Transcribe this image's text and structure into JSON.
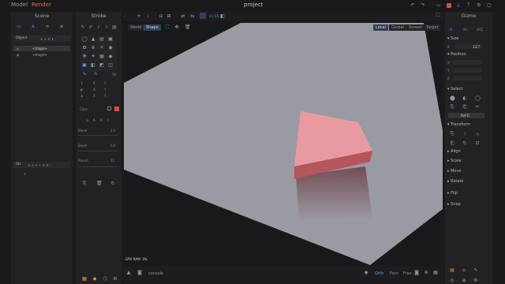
{
  "topbar": {
    "mode_model": "Model",
    "mode_render": "Render",
    "project_title": "project"
  },
  "scene": {
    "title": "Scene",
    "object_header": "Object",
    "items": [
      {
        "label": "<shape>",
        "selected": true
      },
      {
        "label": "<shape>",
        "selected": false
      }
    ],
    "timeline_label": "Str"
  },
  "stroke": {
    "title": "Stroke",
    "xyz": [
      "X",
      "Y",
      "Z"
    ],
    "color_label": "Color",
    "abc": [
      "A",
      "B",
      "C"
    ],
    "blend_label": "Blend",
    "blend_value": "1.0",
    "bevel_label": "Bevel",
    "bevel_value": "0.0",
    "round_label": "Round",
    "round_value": "11"
  },
  "viewport": {
    "tabs_left": [
      "World",
      "Shape"
    ],
    "tabs_right": [
      "Local",
      "Global",
      "Screen",
      "Target"
    ],
    "active_left": "Shape",
    "active_right": "Local",
    "gpu_ram": "GPU RAM: 3%",
    "console_label": "console",
    "projection": [
      "Orth",
      "Pers",
      "Free"
    ],
    "active_projection": "Orth",
    "colors": {
      "floor": "#9a9aa2",
      "shape_top": "#e89aa0",
      "shape_side": "#b5555c",
      "accent": "#e07040"
    }
  },
  "gizmo": {
    "title": "Gizmo",
    "axes": [
      "X",
      "XY",
      "XYZ"
    ],
    "size_label": "Size",
    "size_axis": "Z",
    "size_value": "13.7",
    "position_label": "Position",
    "position_axes": [
      "X",
      "Y",
      "Z"
    ],
    "select_label": "Select",
    "ref_label": "Ref-D",
    "transform_label": "Transform",
    "transform_keys": [
      "T",
      "R"
    ],
    "sections": [
      "Align",
      "Scale",
      "Move",
      "Rotate",
      "Flip",
      "Snap"
    ]
  }
}
